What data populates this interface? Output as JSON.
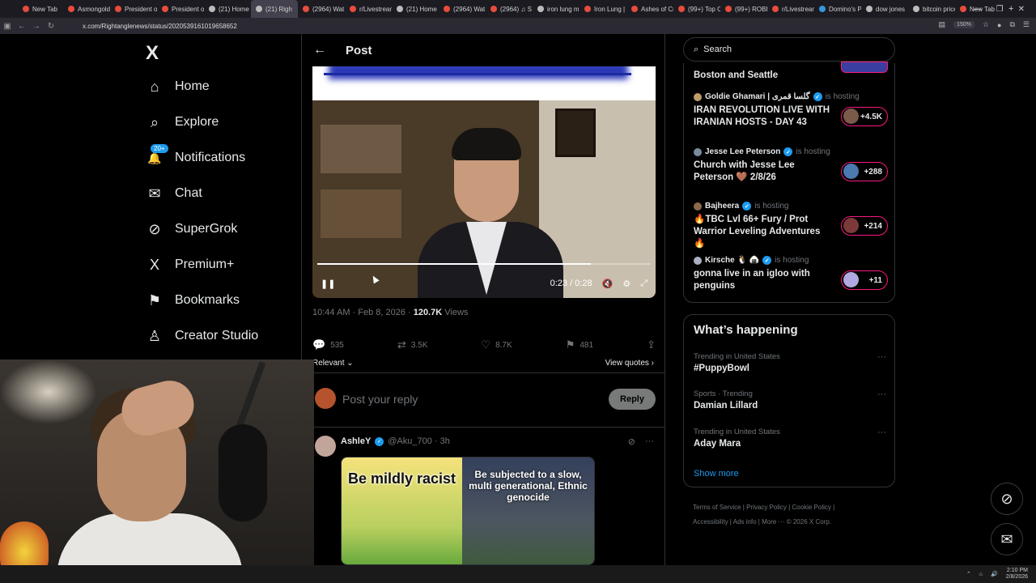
{
  "browser": {
    "tabs": [
      {
        "label": "New Tab",
        "color": "#e74c3c"
      },
      {
        "label": "Asmongold",
        "color": "#e74c3c"
      },
      {
        "label": "President of",
        "color": "#e74c3c"
      },
      {
        "label": "President of",
        "color": "#e74c3c"
      },
      {
        "label": "(21) Home",
        "color": "#bbbbbb"
      },
      {
        "label": "(21) Righ",
        "color": "#bbbbbb",
        "active": true
      },
      {
        "label": "(2964) Wat",
        "color": "#e74c3c"
      },
      {
        "label": "r/Livestream",
        "color": "#e74c3c"
      },
      {
        "label": "(21) Home",
        "color": "#bbbbbb"
      },
      {
        "label": "(2964) Wat",
        "color": "#e74c3c"
      },
      {
        "label": "(2964) ♫ S",
        "color": "#e74c3c"
      },
      {
        "label": "iron lung m",
        "color": "#bbbbbb"
      },
      {
        "label": "Iron Lung |",
        "color": "#e74c3c"
      },
      {
        "label": "Ashes of Cr",
        "color": "#e74c3c"
      },
      {
        "label": "(99+) Top C",
        "color": "#e74c3c"
      },
      {
        "label": "(99+) ROBL",
        "color": "#e74c3c"
      },
      {
        "label": "r/Livestream",
        "color": "#e74c3c"
      },
      {
        "label": "Domino's Pi",
        "color": "#3498db"
      },
      {
        "label": "dow jones",
        "color": "#bbbbbb"
      },
      {
        "label": "bitcoin price",
        "color": "#bbbbbb"
      },
      {
        "label": "New Tab",
        "color": "#e74c3c"
      }
    ],
    "url": "x.com/Rightanglenews/status/2020539161019658652",
    "zoom": "150%"
  },
  "sidebar": {
    "logo": "X",
    "items": [
      {
        "label": "Home",
        "icon": "⌂"
      },
      {
        "label": "Explore",
        "icon": "⌕"
      },
      {
        "label": "Notifications",
        "icon": "🔔",
        "badge": "20+"
      },
      {
        "label": "Chat",
        "icon": "✉"
      },
      {
        "label": "SuperGrok",
        "icon": "⊘"
      },
      {
        "label": "Premium+",
        "icon": "X"
      },
      {
        "label": "Bookmarks",
        "icon": "⚑"
      },
      {
        "label": "Creator Studio",
        "icon": "♙"
      }
    ]
  },
  "post": {
    "header_title": "Post",
    "video": {
      "time": "0:23 / 0:28",
      "progress": 0.82
    },
    "meta_time": "10:44 AM · Feb 8, 2026 · ",
    "meta_views": "120.7K",
    "meta_views_label": " Views",
    "actions": {
      "replies": "535",
      "reposts": "3.5K",
      "likes": "8.7K",
      "bookmarks": "481"
    },
    "sort": "Relevant ⌄",
    "view_quotes": "View quotes ›",
    "reply_placeholder": "Post your reply",
    "reply_button": "Reply"
  },
  "reply_tweet": {
    "name": "AshleY",
    "handle": "@Aku_700 · 3h",
    "meme_left": "Be mildly racist",
    "meme_right": "Be subjected to a slow, multi generational, Ethnic genocide"
  },
  "right": {
    "search_placeholder": "Search",
    "spaces": [
      {
        "host": "",
        "hosting": "",
        "title": "Boston and Seattle",
        "count": ""
      },
      {
        "host": "Goldie Ghamari | گلسا قمری",
        "hosting": "is hosting",
        "title": "IRAN REVOLUTION LIVE WITH IRANIAN HOSTS - DAY 43",
        "count": "+4.5K"
      },
      {
        "host": "Jesse Lee Peterson",
        "hosting": "is hosting",
        "title": "Church with Jesse Lee Peterson 🤎 2/8/26",
        "count": "+288"
      },
      {
        "host": "Bajheera",
        "hosting": "is hosting",
        "title": "🔥TBC Lvl 66+ Fury / Prot Warrior Leveling Adventures🔥",
        "count": "+214"
      },
      {
        "host": "Kirsche 🐧 🍙",
        "hosting": "is hosting",
        "title": "gonna live in an igloo with penguins",
        "count": "+11"
      }
    ],
    "happening_title": "What’s happening",
    "trends": [
      {
        "context": "Trending in United States",
        "name": "#PuppyBowl"
      },
      {
        "context": "Sports · Trending",
        "name": "Damian Lillard"
      },
      {
        "context": "Trending in United States",
        "name": "Aday Mara"
      }
    ],
    "show_more": "Show more",
    "footer_line1": "Terms of Service  |  Privacy Policy  |  Cookie Policy  |",
    "footer_line2": "Accessibility  |  Ads info  |  More ···  © 2026 X Corp."
  },
  "taskbar": {
    "time": "2:10 PM",
    "date": "2/8/2026"
  }
}
